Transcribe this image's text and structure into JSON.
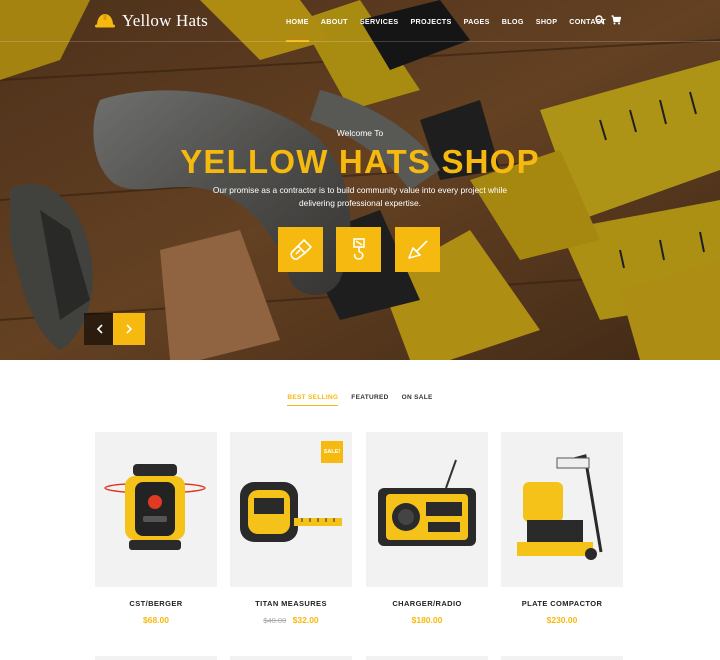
{
  "brand": {
    "name": "Yellow Hats"
  },
  "colors": {
    "accent": "#f5b90f",
    "card_bg": "#f2f2f2"
  },
  "nav": {
    "items": [
      {
        "label": "HOME",
        "active": true
      },
      {
        "label": "ABOUT"
      },
      {
        "label": "SERVICES"
      },
      {
        "label": "PROJECTS"
      },
      {
        "label": "PAGES"
      },
      {
        "label": "BLOG"
      },
      {
        "label": "SHOP"
      },
      {
        "label": "CONTACT"
      }
    ],
    "icons": [
      "search-icon",
      "cart-icon"
    ]
  },
  "hero": {
    "welcome": "Welcome To",
    "title": "YELLOW HATS SHOP",
    "description": "Our promise as a contractor is to build community value into every project while delivering professional expertise.",
    "features": [
      "paint-brush-icon",
      "crane-hook-icon",
      "trowel-icon"
    ],
    "arrows": [
      "chevron-left-icon",
      "chevron-right-icon"
    ]
  },
  "tabs": [
    {
      "label": "BEST SELLING",
      "active": true
    },
    {
      "label": "FEATURED"
    },
    {
      "label": "ON SALE"
    }
  ],
  "products": [
    {
      "name": "CST/BERGER",
      "price": "$68.00"
    },
    {
      "name": "TITAN MEASURES",
      "old_price": "$40.00",
      "price": "$32.00",
      "badge": "SALE!"
    },
    {
      "name": "CHARGER/RADIO",
      "price": "$180.00"
    },
    {
      "name": "PLATE COMPACTOR",
      "price": "$230.00"
    }
  ]
}
